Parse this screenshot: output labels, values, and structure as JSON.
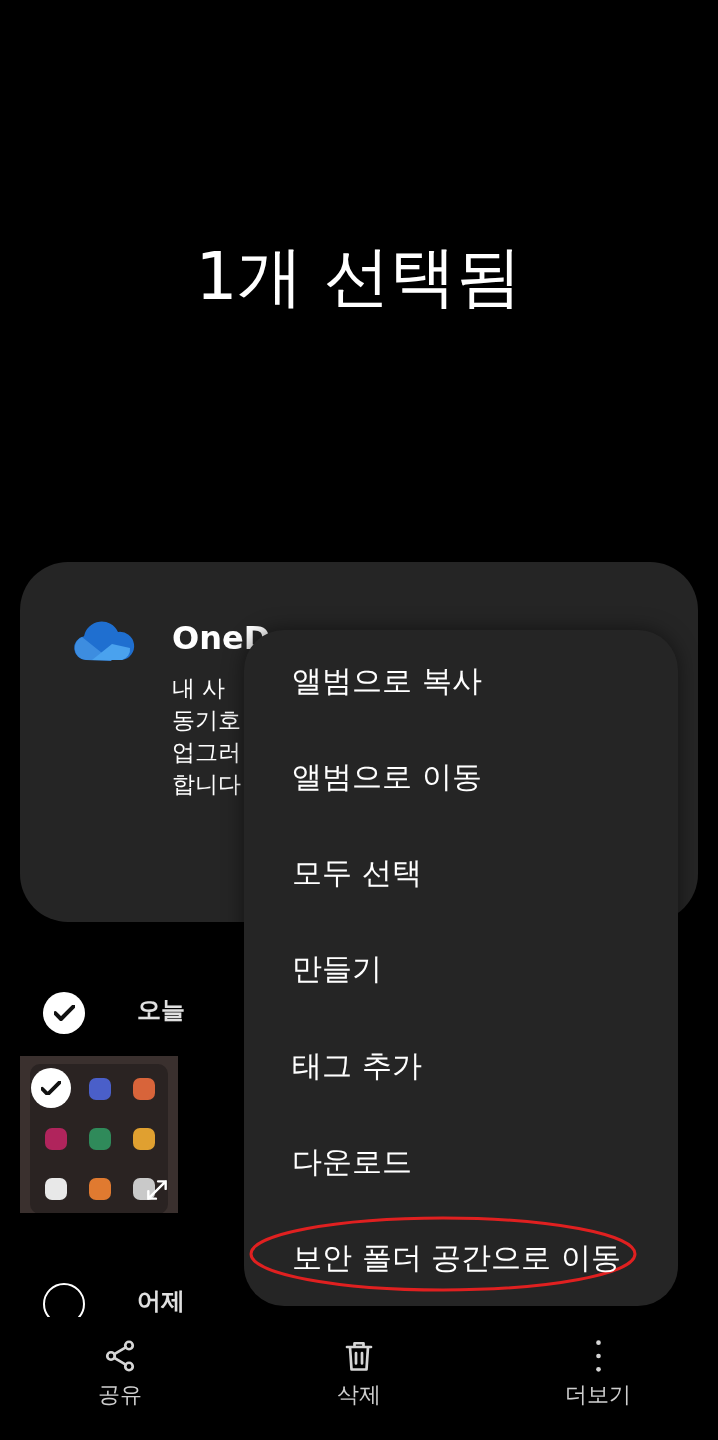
{
  "header": {
    "title": "1개 선택됨"
  },
  "card": {
    "title": "OneD",
    "lines": [
      "내 사",
      "동기호",
      "업그러",
      "합니다"
    ]
  },
  "sections": [
    {
      "label": "오늘",
      "selected": true,
      "items": [
        {
          "kind": "picture",
          "selected": true
        }
      ]
    },
    {
      "label": "어제",
      "selected": false
    }
  ],
  "menu": {
    "items": [
      {
        "label": "앨범으로 복사",
        "highlighted": false
      },
      {
        "label": "앨범으로 이동",
        "highlighted": false
      },
      {
        "label": "모두 선택",
        "highlighted": false
      },
      {
        "label": "만들기",
        "highlighted": false
      },
      {
        "label": "태그 추가",
        "highlighted": false
      },
      {
        "label": "다운로드",
        "highlighted": false
      },
      {
        "label": "보안 폴더 공간으로 이동",
        "highlighted": true
      }
    ]
  },
  "bottom_bar": [
    {
      "kind": "share",
      "label": "공유"
    },
    {
      "kind": "delete",
      "label": "삭제"
    },
    {
      "kind": "more",
      "label": "더보기"
    }
  ]
}
